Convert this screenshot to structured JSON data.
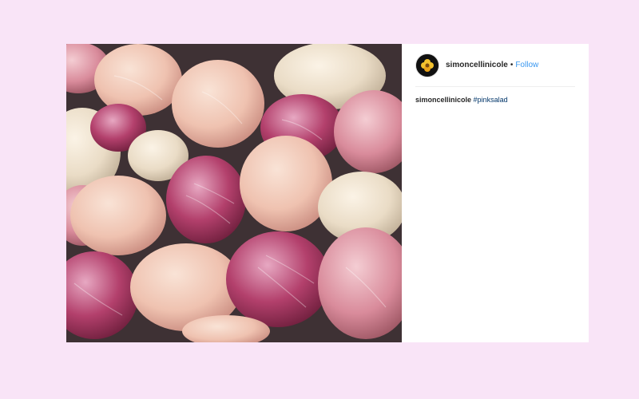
{
  "post": {
    "image_alt": "pile of pink radicchio heads",
    "image_colors": {
      "background": "#4a3a3f",
      "pale_pink": "#f0c6b6",
      "cream": "#efe3d2",
      "magenta": "#a8325e",
      "rose": "#d78a9c"
    },
    "author": {
      "username": "simoncellinicole",
      "separator": "•",
      "follow_label": "Follow",
      "avatar_icon": "avatar-flower-icon"
    },
    "caption": {
      "username": "simoncellinicole",
      "hashtag": "#pinksalad"
    }
  },
  "colors": {
    "page_background": "#f9e4f7",
    "link_blue": "#3897f0",
    "hashtag_blue": "#003569",
    "text": "#262626"
  }
}
